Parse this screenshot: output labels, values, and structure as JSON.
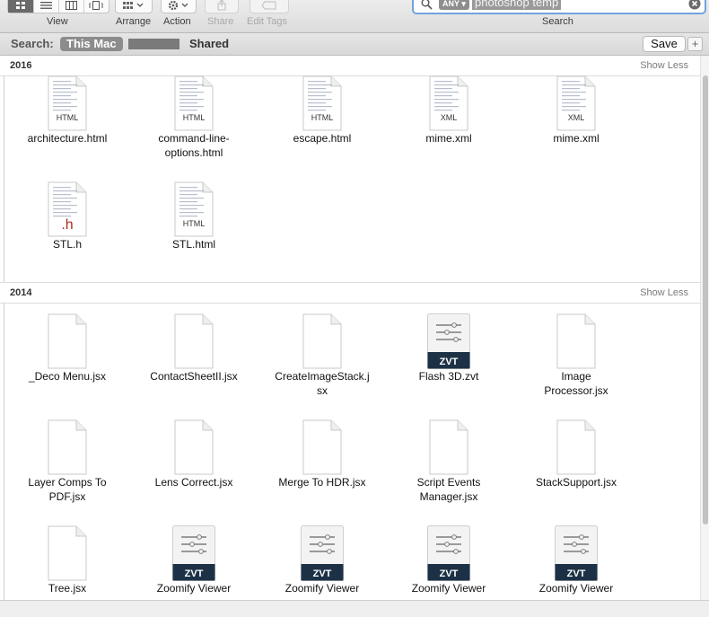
{
  "toolbar": {
    "view_label": "View",
    "arrange_label": "Arrange",
    "action_label": "Action",
    "share_label": "Share",
    "edit_tags_label": "Edit Tags",
    "search_label": "Search"
  },
  "search": {
    "token": "ANY",
    "query": "photoshop temp"
  },
  "scope": {
    "label": "Search:",
    "this_mac": "This Mac",
    "shared": "Shared",
    "save": "Save",
    "add": "+"
  },
  "sections": [
    {
      "year": "2016",
      "show_less": "Show Less",
      "items": [
        {
          "name": "architecture.html",
          "type": "HTML"
        },
        {
          "name": "command-line-\noptions.html",
          "type": "HTML"
        },
        {
          "name": "escape.html",
          "type": "HTML"
        },
        {
          "name": "mime.xml",
          "type": "XML"
        },
        {
          "name": "mime.xml",
          "type": "XML"
        },
        {
          "name": "STL.h",
          "type": ".h"
        },
        {
          "name": "STL.html",
          "type": "HTML"
        }
      ]
    },
    {
      "year": "2014",
      "show_less": "Show Less",
      "items": [
        {
          "name": "_Deco Menu.jsx",
          "type": ""
        },
        {
          "name": "ContactSheetII.jsx",
          "type": ""
        },
        {
          "name": "CreateImageStack.j\nsx",
          "type": ""
        },
        {
          "name": "Flash 3D.zvt",
          "type": "ZVT"
        },
        {
          "name": "Image\nProcessor.jsx",
          "type": ""
        },
        {
          "name": "Layer Comps To\nPDF.jsx",
          "type": ""
        },
        {
          "name": "Lens Correct.jsx",
          "type": ""
        },
        {
          "name": "Merge To HDR.jsx",
          "type": ""
        },
        {
          "name": "Script Events\nManager.jsx",
          "type": ""
        },
        {
          "name": "StackSupport.jsx",
          "type": ""
        },
        {
          "name": "Tree.jsx",
          "type": ""
        },
        {
          "name": "Zoomify Viewer",
          "type": "ZVT"
        },
        {
          "name": "Zoomify Viewer",
          "type": "ZVT"
        },
        {
          "name": "Zoomify Viewer",
          "type": "ZVT"
        },
        {
          "name": "Zoomify Viewer",
          "type": "ZVT"
        }
      ]
    }
  ],
  "colors": {
    "accent": "#6fa4e0",
    "zvt_band": "#1d3146",
    "h_badge": "#b22a1f"
  }
}
